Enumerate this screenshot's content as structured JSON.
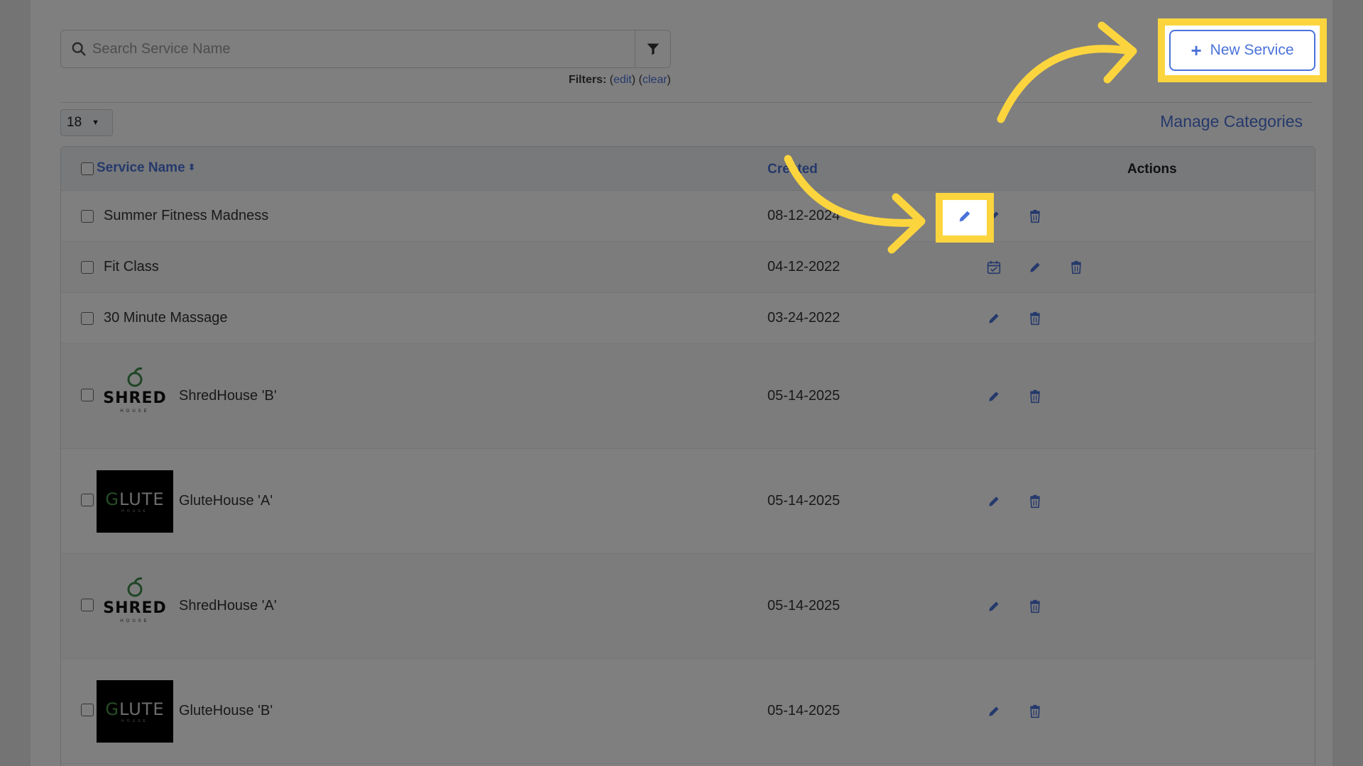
{
  "search": {
    "placeholder": "Search Service Name"
  },
  "filters": {
    "label": "Filters:",
    "edit": "edit",
    "clear": "clear"
  },
  "page_size": "18",
  "manage_categories": "Manage Categories",
  "new_service": "New Service",
  "table": {
    "columns": {
      "name": "Service Name",
      "created": "Created",
      "actions": "Actions"
    },
    "rows": [
      {
        "name": "Summer Fitness Madness",
        "date": "08-12-2024",
        "actions": [
          "edit",
          "delete"
        ]
      },
      {
        "name": "Fit Class",
        "date": "04-12-2022",
        "actions": [
          "calendar",
          "edit",
          "delete"
        ]
      },
      {
        "name": "30 Minute Massage",
        "date": "03-24-2022",
        "actions": [
          "edit",
          "delete"
        ]
      },
      {
        "name": "ShredHouse 'B'",
        "date": "05-14-2025",
        "actions": [
          "edit",
          "delete"
        ],
        "logo": "SHRED"
      },
      {
        "name": "GluteHouse 'A'",
        "date": "05-14-2025",
        "actions": [
          "edit",
          "delete"
        ],
        "logo": "LUTE"
      },
      {
        "name": "ShredHouse 'A'",
        "date": "05-14-2025",
        "actions": [
          "edit",
          "delete"
        ],
        "logo": "SHRED"
      },
      {
        "name": "GluteHouse 'B'",
        "date": "05-14-2025",
        "actions": [
          "edit",
          "delete"
        ],
        "logo": "LUTE"
      }
    ]
  },
  "logos": {
    "shred_sub": "HOUSE",
    "glute_sub": "HOUSE"
  },
  "colors": {
    "accent": "#4a72d9",
    "highlight": "#fcd53e"
  },
  "icons": {
    "search": "search-icon",
    "filter": "filter-icon",
    "edit": "pencil-icon",
    "delete": "trash-icon",
    "calendar": "calendar-check-icon"
  }
}
